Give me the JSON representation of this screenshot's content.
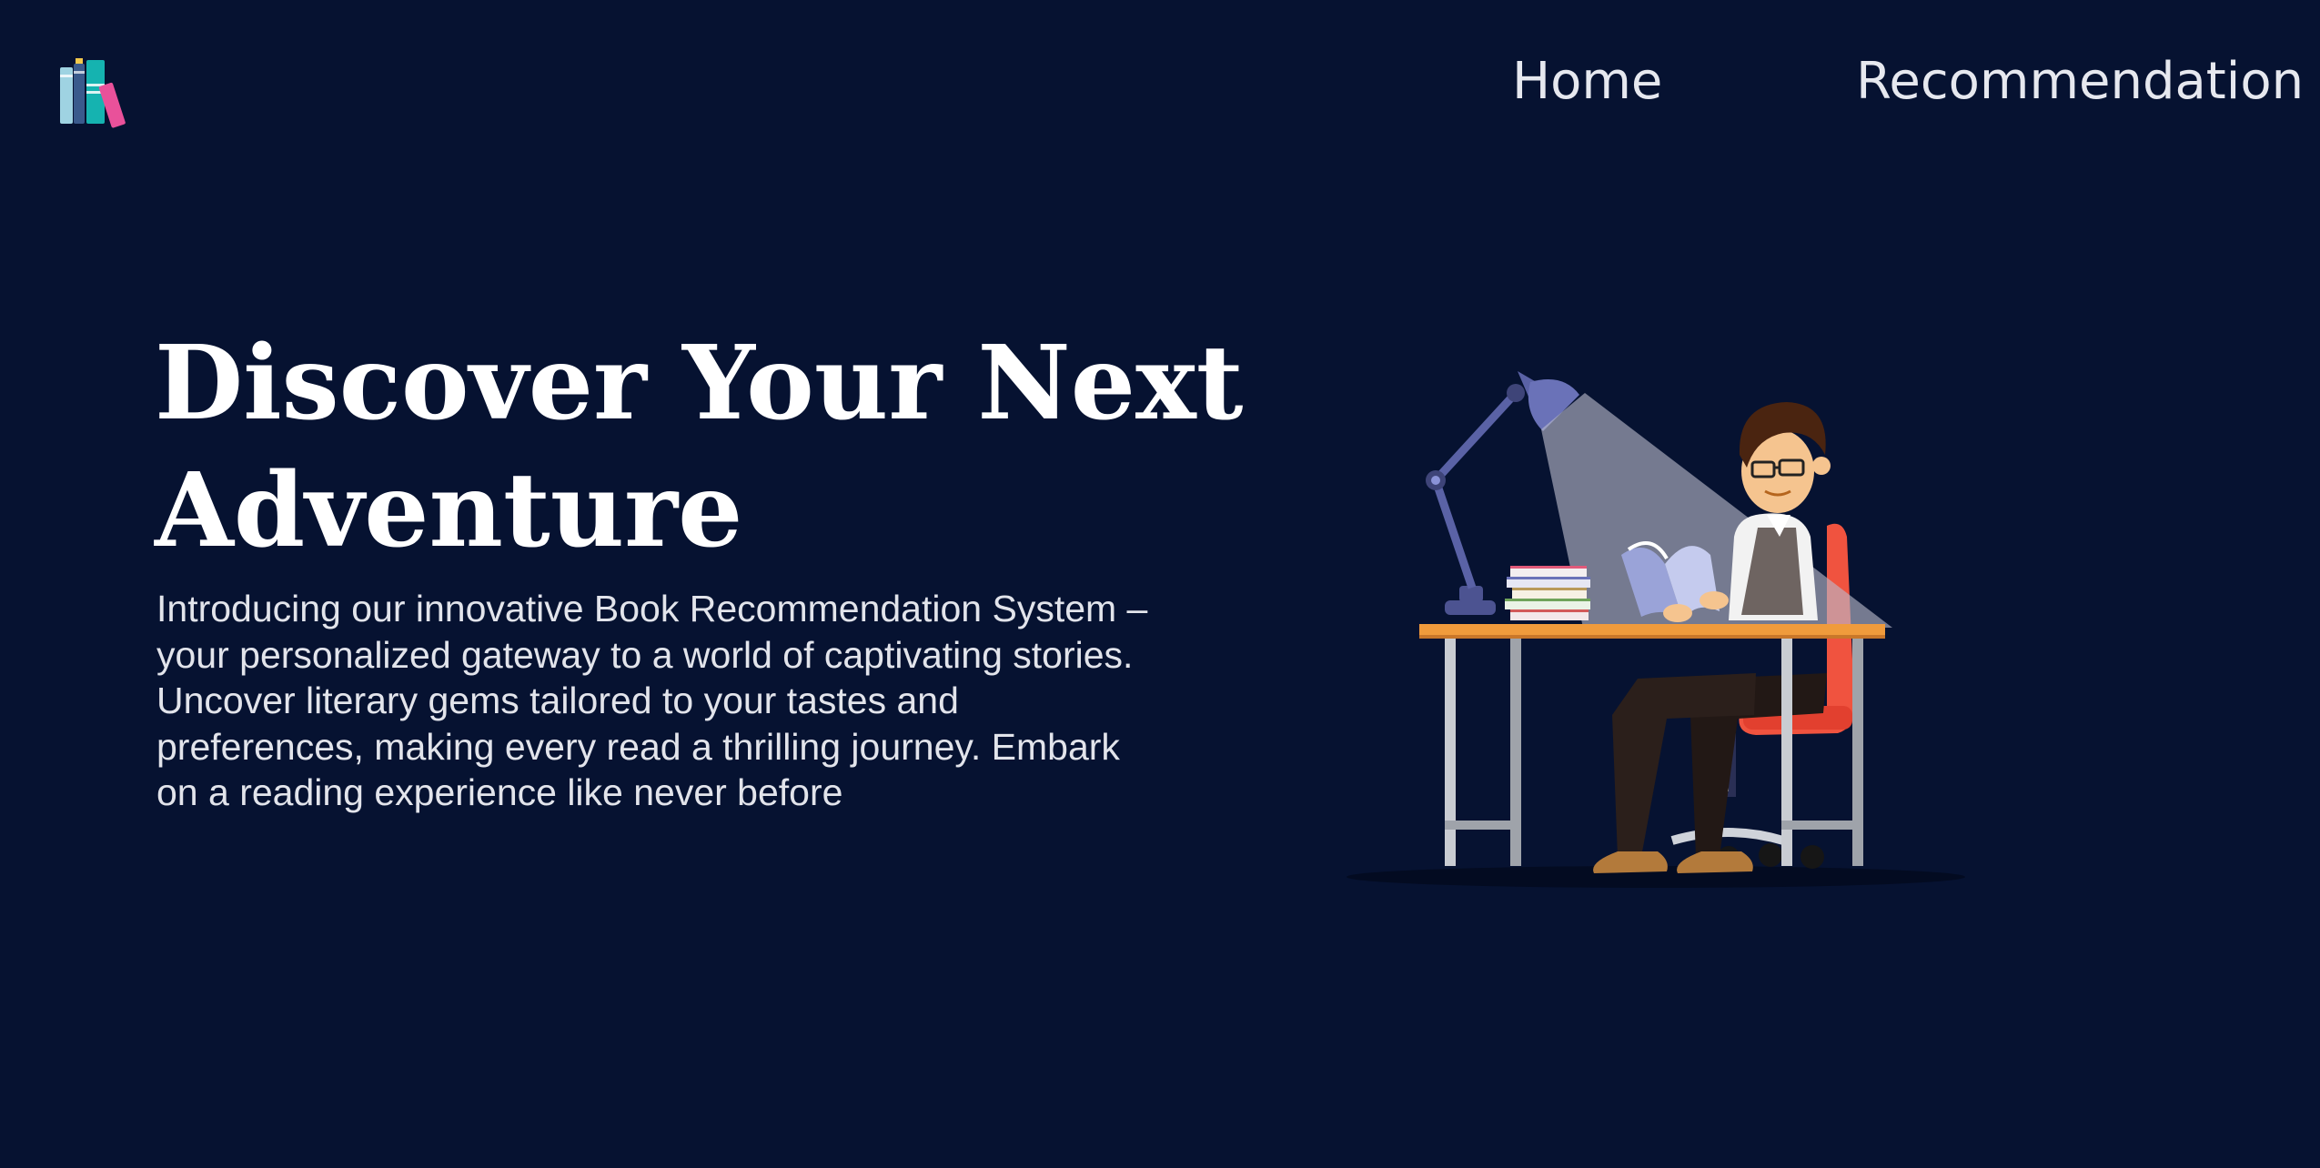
{
  "header": {
    "logo_name": "books-logo",
    "nav": {
      "home_label": "Home",
      "recommendation_label": "Recommendation"
    }
  },
  "hero": {
    "title": "Discover Your Next Adventure",
    "description": "Introducing our innovative Book Recommendation System – your personalized gateway to a world of captivating stories. Uncover literary gems tailored to your tastes and preferences, making every read a thrilling journey. Embark on a reading experience like never before",
    "illustration": "person-reading-at-desk-illustration"
  },
  "colors": {
    "background": "#061231",
    "text": "#ffffff",
    "nav_text": "#e6e8ef",
    "book_teal": "#15b3b0",
    "book_pink": "#e9519a",
    "book_light_blue": "#9fd3e2",
    "chair_red": "#f0533f",
    "desk_orange": "#f09b3c",
    "lamp_blue": "#5a62a6"
  }
}
